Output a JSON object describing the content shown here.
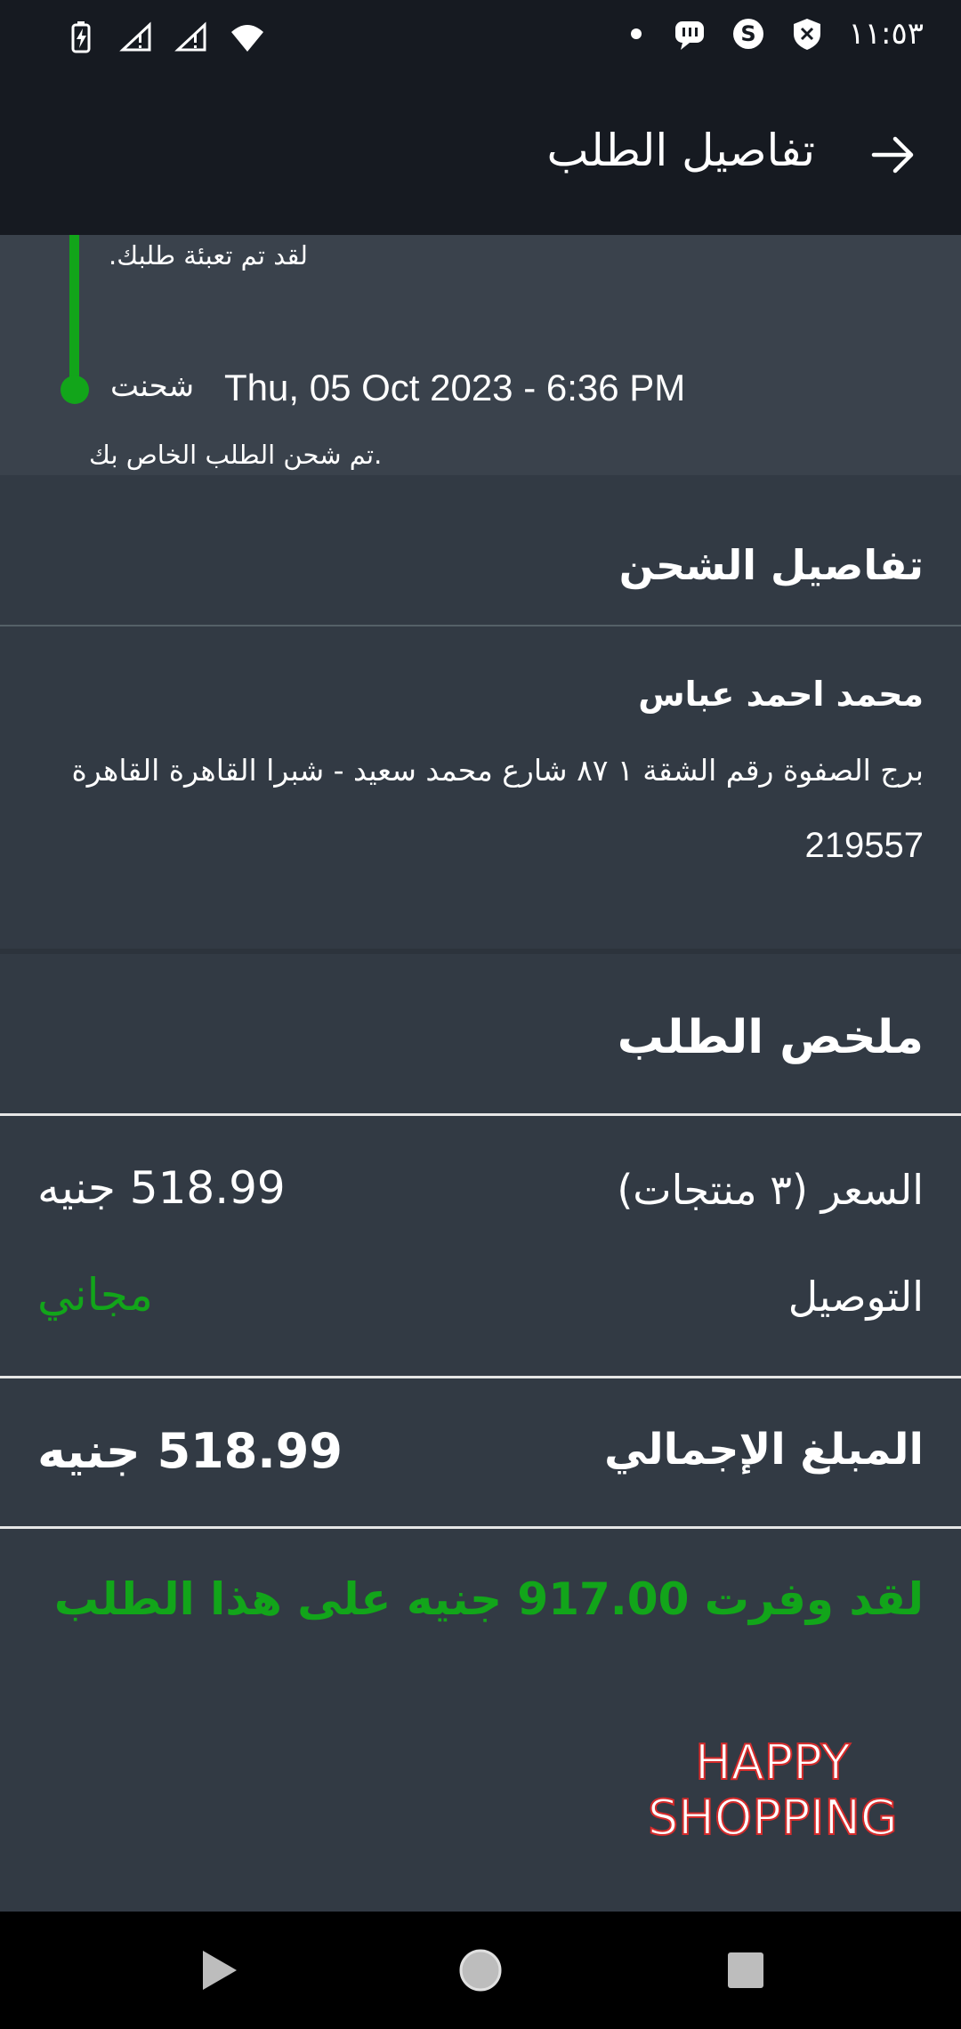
{
  "status_bar": {
    "time": "١١:٥٣",
    "icons": [
      "battery-charging-icon",
      "signal-icon",
      "signal-icon",
      "wifi-icon",
      "dot-icon",
      "chat-icon",
      "s-app-icon",
      "shield-icon"
    ]
  },
  "app_bar": {
    "title": "تفاصيل الطلب",
    "back_icon": "arrow-back-icon"
  },
  "timeline": {
    "packed_note": "لقد تم تعبئة طلبك.",
    "status_label": "شحنت",
    "status_date": "Thu, 05 Oct 2023 - 6:36 PM",
    "shipped_note": "تم شحن الطلب الخاص بك.",
    "accent": "#12a51a"
  },
  "shipping": {
    "header": "تفاصيل الشحن",
    "name": "محمد احمد عباس",
    "address_line": "برج الصفوة رقم الشقة ١ ٨٧ شارع محمد سعيد - شبرا  القاهرة القاهرة",
    "zip": "219557"
  },
  "summary": {
    "header": "ملخص الطلب",
    "price_label": "السعر (٣ منتجات)",
    "price_value": "518.99 جنيه",
    "delivery_label": "التوصيل",
    "delivery_value": "مجاني",
    "total_label": "المبلغ الإجمالي",
    "total_value": "518.99 جنيه",
    "saved_text": "لقد وفرت 917.00 جنيه على هذا الطلب"
  },
  "footer": {
    "happy_line1": "HAPPY",
    "happy_line2": "SHOPPING"
  },
  "nav_bar": {
    "icons": [
      "nav-back-icon",
      "nav-home-icon",
      "nav-recents-icon"
    ]
  }
}
